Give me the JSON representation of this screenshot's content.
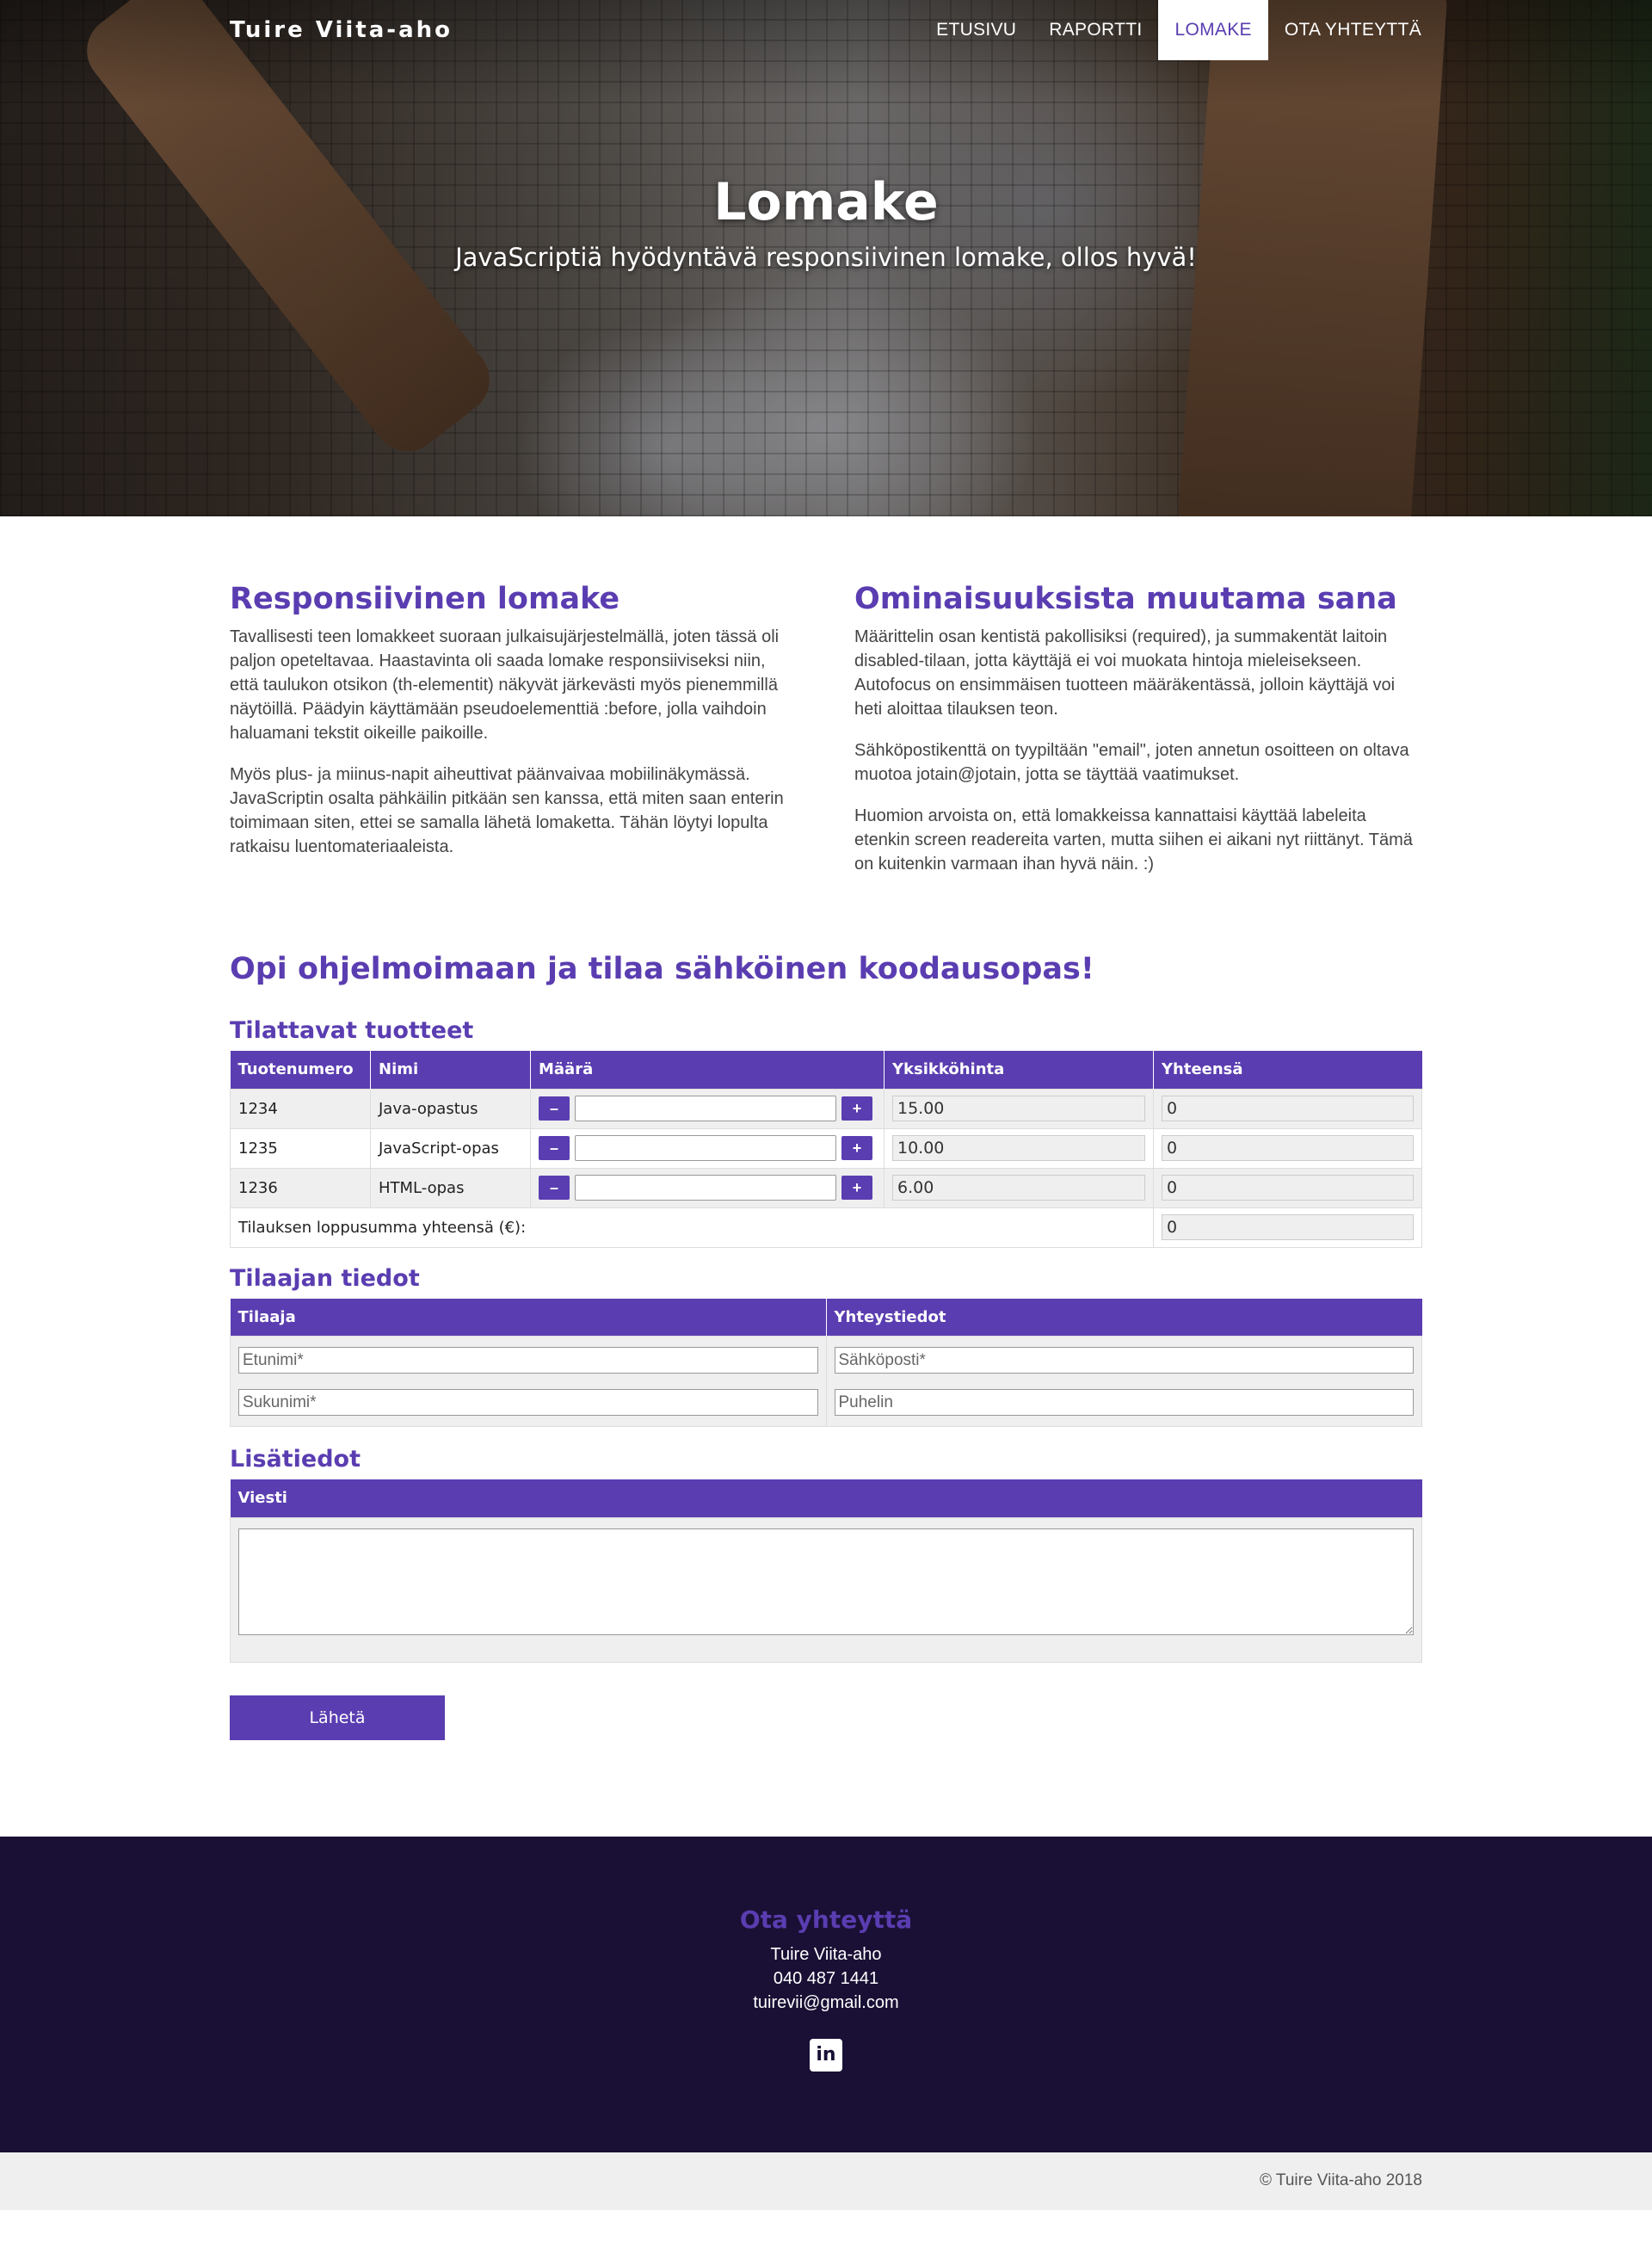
{
  "nav": {
    "brand": "Tuire Viita-aho",
    "links": [
      "ETUSIVU",
      "RAPORTTI",
      "LOMAKE",
      "OTA YHTEYTTÄ"
    ],
    "active": "LOMAKE"
  },
  "hero": {
    "title": "Lomake",
    "subtitle": "JavaScriptiä hyödyntävä responsiivinen lomake, ollos hyvä!"
  },
  "intro": {
    "left": {
      "heading": "Responsiivinen lomake",
      "paragraphs": [
        "Tavallisesti teen lomakkeet suoraan julkaisujärjestelmällä, joten tässä oli paljon opeteltavaa. Haastavinta oli saada lomake responsiiviseksi niin, että taulukon otsikon (th-elementit) näkyvät järkevästi myös pienemmillä näytöillä. Päädyin käyttämään pseudoelementtiä :before, jolla vaihdoin haluamani tekstit oikeille paikoille.",
        "Myös plus- ja miinus-napit aiheuttivat päänvaivaa mobiilinäkymässä. JavaScriptin osalta pähkäilin pitkään sen kanssa, että miten saan enterin toimimaan siten, ettei se samalla lähetä lomaketta. Tähän löytyi lopulta ratkaisu luentomateriaaleista."
      ]
    },
    "right": {
      "heading": "Ominaisuuksista muutama sana",
      "paragraphs": [
        "Määrittelin osan kentistä pakollisiksi (required), ja summakentät laitoin disabled-tilaan, jotta käyttäjä ei voi muokata hintoja mieleisekseen. Autofocus on ensimmäisen tuotteen määräkentässä, jolloin käyttäjä voi heti aloittaa tilauksen teon.",
        "Sähköpostikenttä on tyypiltään \"email\", joten annetun osoitteen on oltava muotoa jotain@jotain, jotta se täyttää vaatimukset.",
        "Huomion arvoista on, että lomakkeissa kannattaisi käyttää labeleita etenkin screen readereita varten, mutta siihen ei aikani nyt riittänyt. Tämä on kuitenkin varmaan ihan hyvä näin. :)"
      ]
    }
  },
  "order": {
    "heading": "Opi ohjelmoimaan ja tilaa sähköinen koodausopas!",
    "products_heading": "Tilattavat tuotteet",
    "columns": [
      "Tuotenumero",
      "Nimi",
      "Määrä",
      "Yksikköhinta",
      "Yhteensä"
    ],
    "rows": [
      {
        "id": "1234",
        "name": "Java-opastus",
        "qty": "",
        "price": "15.00",
        "total": "0"
      },
      {
        "id": "1235",
        "name": "JavaScript-opas",
        "qty": "",
        "price": "10.00",
        "total": "0"
      },
      {
        "id": "1236",
        "name": "HTML-opas",
        "qty": "",
        "price": "6.00",
        "total": "0"
      }
    ],
    "minus": "–",
    "plus": "+",
    "total_label": "Tilauksen loppusumma yhteensä (€):",
    "grand_total": "0",
    "customer_heading": "Tilaajan tiedot",
    "customer_columns": [
      "Tilaaja",
      "Yhteystiedot"
    ],
    "placeholders": {
      "firstname": "Etunimi*",
      "lastname": "Sukunimi*",
      "email": "Sähköposti*",
      "phone": "Puhelin"
    },
    "extra_heading": "Lisätiedot",
    "extra_column": "Viesti",
    "submit": "Lähetä"
  },
  "footer": {
    "heading": "Ota yhteyttä",
    "name": "Tuire Viita-aho",
    "phone": "040 487 1441",
    "email": "tuirevii@gmail.com",
    "social_icon": "linkedin-icon",
    "copyright": "© Tuire Viita-aho 2018"
  },
  "colors": {
    "accent": "#5a3db1",
    "footer_bg": "#1a1035",
    "copyright_bg": "#efefef"
  }
}
